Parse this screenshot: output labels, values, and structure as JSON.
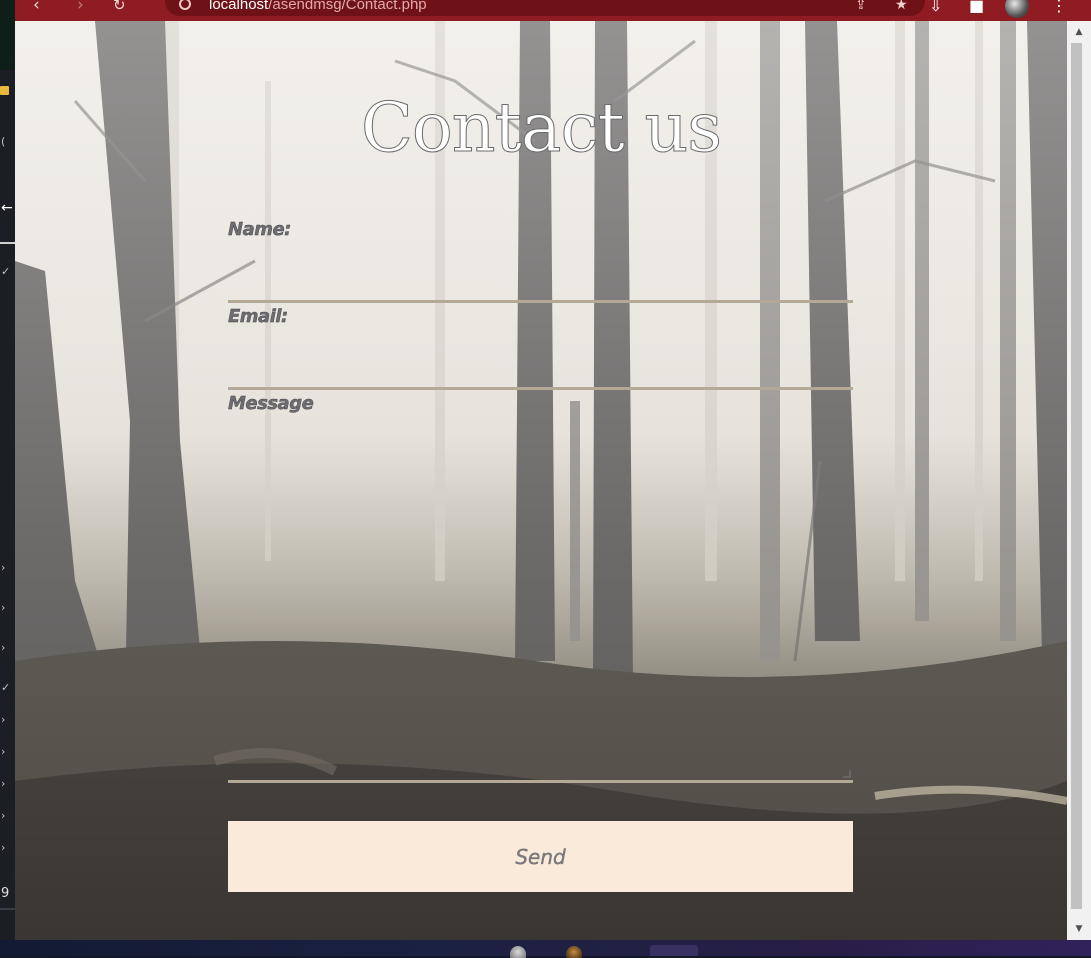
{
  "browser": {
    "url_host": "localhost",
    "url_path": "/asendmsg/Contact.php",
    "icons": [
      "back-icon",
      "forward-icon",
      "reload-icon",
      "site-info-icon",
      "share-icon",
      "bookmark-star-icon",
      "download-icon",
      "extensions-icon",
      "profile-avatar",
      "menu-icon"
    ]
  },
  "page": {
    "title": "Contact us",
    "form": {
      "name_label": "Name:",
      "email_label": "Email:",
      "message_label": "Message",
      "name_value": "",
      "email_value": "",
      "message_value": "",
      "send_label": "Send"
    }
  },
  "left_panel": {
    "line_number": "9"
  },
  "colors": {
    "browser_chrome": "#8e1c22",
    "omnibox": "#6e1218",
    "input_underline": "#b3a996",
    "send_button_bg": "#f9ead9",
    "label_text": "#6e6e72"
  }
}
